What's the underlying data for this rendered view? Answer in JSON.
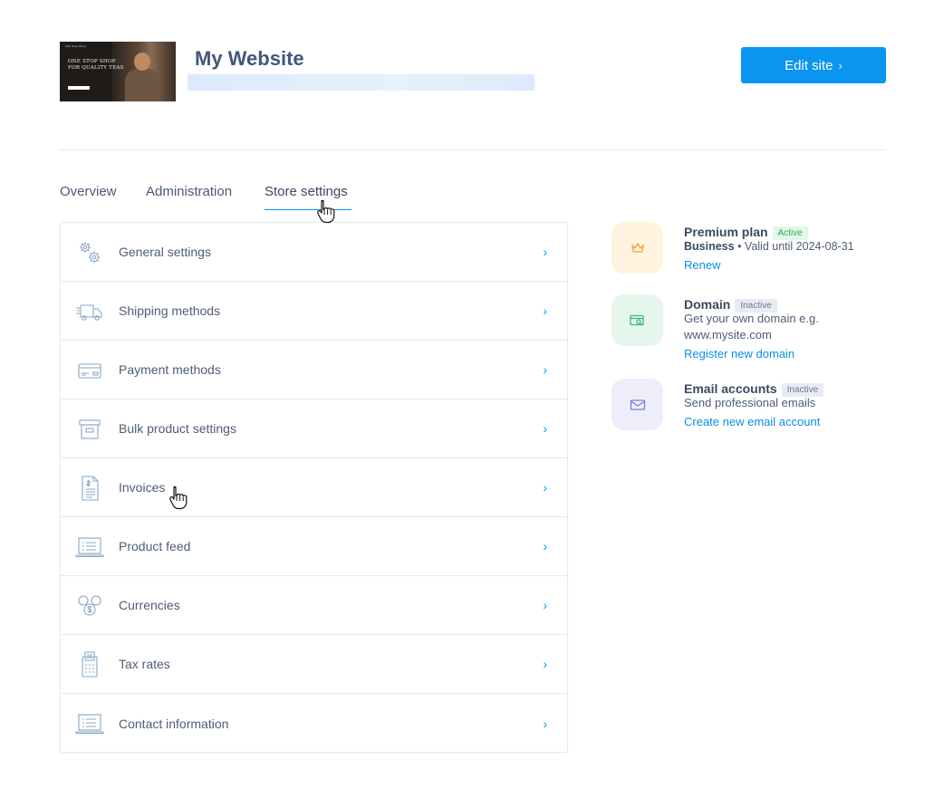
{
  "header": {
    "site_title": "My Website",
    "thumbnail": {
      "top_text": "One Stop Shop",
      "tagline": "ONE STOP SHOP FOR QUALITY TEAS"
    },
    "edit_button": "Edit site",
    "edit_chevron": "›"
  },
  "tabs": [
    {
      "label": "Overview"
    },
    {
      "label": "Administration"
    },
    {
      "label": "Store settings",
      "active": true
    }
  ],
  "settings": [
    {
      "label": "General settings",
      "icon": "gears-icon"
    },
    {
      "label": "Shipping methods",
      "icon": "truck-icon"
    },
    {
      "label": "Payment methods",
      "icon": "credit-card-icon"
    },
    {
      "label": "Bulk product settings",
      "icon": "box-icon"
    },
    {
      "label": "Invoices",
      "icon": "invoice-icon"
    },
    {
      "label": "Product feed",
      "icon": "laptop-list-icon"
    },
    {
      "label": "Currencies",
      "icon": "coins-icon"
    },
    {
      "label": "Tax rates",
      "icon": "calculator-icon"
    },
    {
      "label": "Contact information",
      "icon": "laptop-list-icon"
    }
  ],
  "chevron": "›",
  "services": {
    "premium": {
      "title": "Premium plan",
      "badge": "Active",
      "plan_name": "Business",
      "valid": " • Valid until 2024-08-31",
      "link": "Renew"
    },
    "domain": {
      "title": "Domain",
      "badge": "Inactive",
      "text": "Get your own domain e.g. www.mysite.com",
      "link": "Register new domain"
    },
    "email": {
      "title": "Email accounts",
      "badge": "Inactive",
      "text": "Send professional emails",
      "link": "Create new email account"
    }
  },
  "colors": {
    "accent": "#0a95f0",
    "premium_bg": "#fff4e0",
    "domain_bg": "#e5f7ec",
    "email_bg": "#eeeefb"
  }
}
